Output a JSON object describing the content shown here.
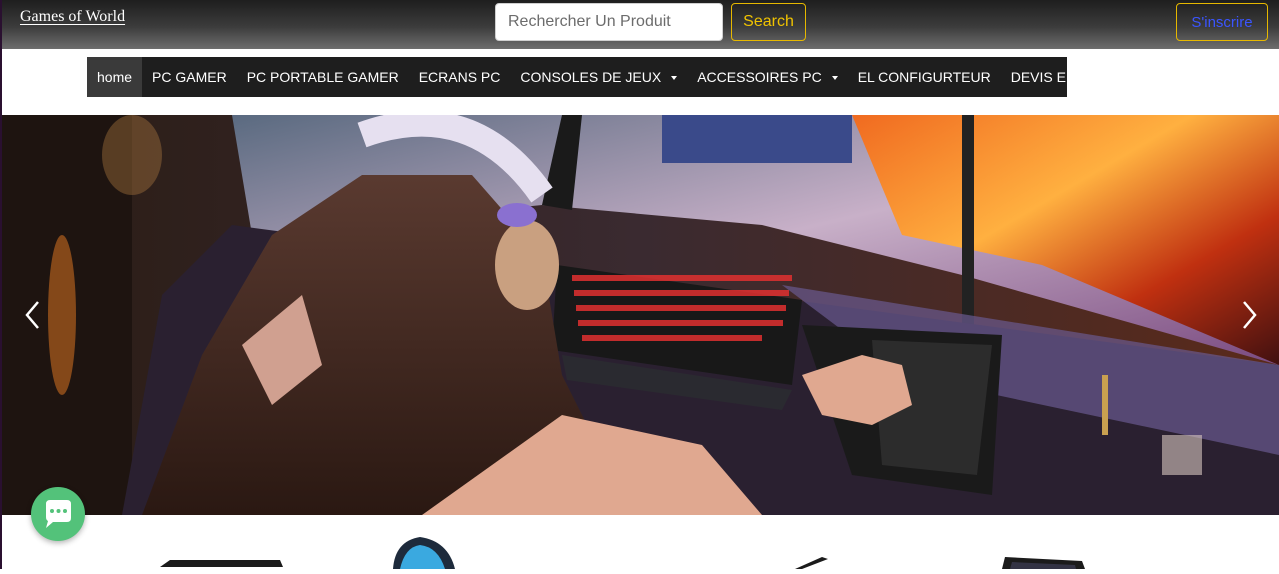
{
  "header": {
    "brand": "Games of World",
    "search": {
      "placeholder": "Rechercher Un Produit",
      "value": ""
    },
    "search_button": "Search",
    "signup_button": "S'inscrire"
  },
  "nav": {
    "items": [
      {
        "label": "home",
        "active": true
      },
      {
        "label": "PC GAMER"
      },
      {
        "label": "PC PORTABLE GAMER"
      },
      {
        "label": "ECRANS PC"
      },
      {
        "label": "CONSOLES DE JEUX",
        "dropdown": true
      },
      {
        "label": "ACCESSOIRES PC",
        "dropdown": true
      },
      {
        "label": "EL CONFIGURTEUR"
      },
      {
        "label": "DEVIS EN LIGNE"
      }
    ]
  },
  "carousel": {
    "image": "gamer-setup-photo",
    "prev_icon": "chevron-left-icon",
    "next_icon": "chevron-right-icon"
  },
  "chat_widget": {
    "icon": "chat-bubble-icon",
    "color": "#53c27a"
  },
  "colors": {
    "accent": "#e6b800",
    "link": "#3b55ff",
    "nav_bg": "#1e1e1e"
  }
}
